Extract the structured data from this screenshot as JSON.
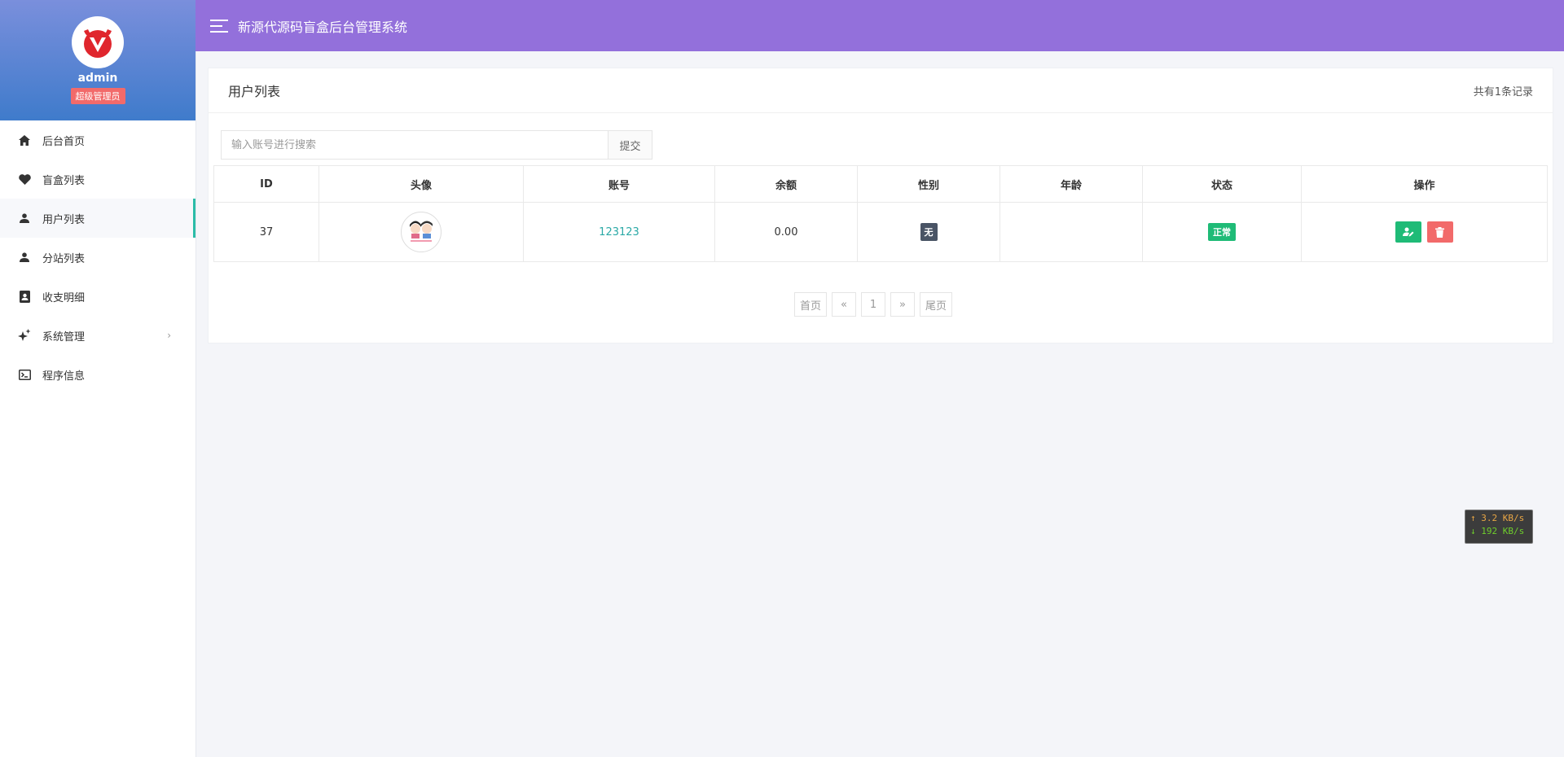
{
  "app": {
    "title": "新源代源码盲盒后台管理系统"
  },
  "profile": {
    "username": "admin",
    "role": "超级管理员"
  },
  "sidebar": {
    "items": [
      {
        "label": "后台首页",
        "icon": "home-icon"
      },
      {
        "label": "盲盒列表",
        "icon": "heart-icon"
      },
      {
        "label": "用户列表",
        "icon": "user-icon",
        "active": true
      },
      {
        "label": "分站列表",
        "icon": "user-icon"
      },
      {
        "label": "收支明细",
        "icon": "contact-book-icon"
      },
      {
        "label": "系统管理",
        "icon": "sparkle-icon",
        "has_submenu": true
      },
      {
        "label": "程序信息",
        "icon": "terminal-icon"
      }
    ],
    "submenu_chevron": "›"
  },
  "panel": {
    "title": "用户列表",
    "record_count": "共有1条记录"
  },
  "search": {
    "placeholder": "输入账号进行搜索",
    "value": "",
    "submit_label": "提交"
  },
  "table": {
    "headers": [
      "ID",
      "头像",
      "账号",
      "余额",
      "性别",
      "年龄",
      "状态",
      "操作"
    ],
    "rows": [
      {
        "id": "37",
        "account": "123123",
        "balance": "0.00",
        "gender": "无",
        "age": "",
        "status": "正常"
      }
    ]
  },
  "pagination": {
    "first": "首页",
    "prev": "«",
    "current": "1",
    "next": "»",
    "last": "尾页"
  },
  "network": {
    "upload": "↑ 3.2 KB/s",
    "download": "↓ 192 KB/s"
  },
  "colors": {
    "header_bg": "#9370db",
    "active_indicator": "#2bbca8",
    "success": "#1fbb77",
    "danger": "#f26a6a",
    "link": "#2aa9a6"
  }
}
